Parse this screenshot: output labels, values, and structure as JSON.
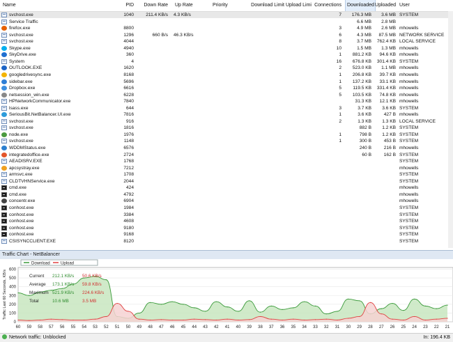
{
  "columns": {
    "name": "Name",
    "pid": "PID",
    "down_rate": "Down Rate",
    "up_rate": "Up Rate",
    "priority": "Priority",
    "download_limit": "Download Limit",
    "upload_limit": "Upload Limit",
    "connections": "Connections",
    "downloaded": "Downloaded",
    "uploaded": "Uploaded",
    "user": "User"
  },
  "rows": [
    {
      "name": "svchost.exe",
      "pid": "1040",
      "down": "211.4 KB/s",
      "up": "4.3 KB/s",
      "conn": "7",
      "dl": "176.3 MB",
      "ul": "3.6 MB",
      "user": "SYSTEM",
      "icon": "app-icon",
      "selected": true
    },
    {
      "name": "Service Traffic",
      "pid": "",
      "down": "",
      "up": "",
      "conn": "",
      "dl": "6.6 MB",
      "ul": "2.8 MB",
      "user": "",
      "icon": "page-icon"
    },
    {
      "name": "firefox.exe",
      "pid": "8800",
      "down": "",
      "up": "",
      "conn": "3",
      "dl": "4.9 MB",
      "ul": "2.6 MB",
      "user": "mhowells",
      "icon": "firefox-icon"
    },
    {
      "name": "svchost.exe",
      "pid": "1296",
      "down": "660 B/s",
      "up": "46.3 KB/s",
      "conn": "6",
      "dl": "4.3 MB",
      "ul": "87.5 MB",
      "user": "NETWORK SERVICE",
      "icon": "app-icon"
    },
    {
      "name": "svchost.exe",
      "pid": "4044",
      "down": "",
      "up": "",
      "conn": "8",
      "dl": "3.7 MB",
      "ul": "762.4 KB",
      "user": "LOCAL SERVICE",
      "icon": "app-icon"
    },
    {
      "name": "Skype.exe",
      "pid": "4940",
      "down": "",
      "up": "",
      "conn": "10",
      "dl": "1.5 MB",
      "ul": "1.3 MB",
      "user": "mhowells",
      "icon": "skype-icon"
    },
    {
      "name": "SkyDrive.exe",
      "pid": "360",
      "down": "",
      "up": "",
      "conn": "1",
      "dl": "881.2 KB",
      "ul": "94.6 KB",
      "user": "mhowells",
      "icon": "skydrive-icon"
    },
    {
      "name": "System",
      "pid": "4",
      "down": "",
      "up": "",
      "conn": "16",
      "dl": "676.8 KB",
      "ul": "301.4 KB",
      "user": "SYSTEM",
      "icon": "page-icon"
    },
    {
      "name": "OUTLOOK.EXE",
      "pid": "1620",
      "down": "",
      "up": "",
      "conn": "2",
      "dl": "523.0 KB",
      "ul": "1.1 MB",
      "user": "mhowells",
      "icon": "outlook-icon"
    },
    {
      "name": "googledrivesync.exe",
      "pid": "8168",
      "down": "",
      "up": "",
      "conn": "1",
      "dl": "206.8 KB",
      "ul": "39.7 KB",
      "user": "mhowells",
      "icon": "drive-icon"
    },
    {
      "name": "sidebar.exe",
      "pid": "5696",
      "down": "",
      "up": "",
      "conn": "1",
      "dl": "137.2 KB",
      "ul": "33.1 KB",
      "user": "mhowells",
      "icon": "sidebar-icon"
    },
    {
      "name": "Dropbox.exe",
      "pid": "6616",
      "down": "",
      "up": "",
      "conn": "5",
      "dl": "119.5 KB",
      "ul": "331.4 KB",
      "user": "mhowells",
      "icon": "dropbox-icon"
    },
    {
      "name": "netsession_win.exe",
      "pid": "6228",
      "down": "",
      "up": "",
      "conn": "5",
      "dl": "103.5 KB",
      "ul": "74.8 KB",
      "user": "mhowells",
      "icon": "netsession-icon"
    },
    {
      "name": "HPNetworkCommunicator.exe",
      "pid": "7840",
      "down": "",
      "up": "",
      "conn": "",
      "dl": "31.3 KB",
      "ul": "12.1 KB",
      "user": "mhowells",
      "icon": "app-icon"
    },
    {
      "name": "lsass.exe",
      "pid": "644",
      "down": "",
      "up": "",
      "conn": "3",
      "dl": "3.7 KB",
      "ul": "3.6 KB",
      "user": "SYSTEM",
      "icon": "app-icon"
    },
    {
      "name": "SeriousBit.NetBalancer.UI.exe",
      "pid": "7816",
      "down": "",
      "up": "",
      "conn": "1",
      "dl": "3.6 KB",
      "ul": "427 B",
      "user": "mhowells",
      "icon": "netbalancer-icon"
    },
    {
      "name": "svchost.exe",
      "pid": "916",
      "down": "",
      "up": "",
      "conn": "2",
      "dl": "1.3 KB",
      "ul": "1.3 KB",
      "user": "LOCAL SERVICE",
      "icon": "app-icon"
    },
    {
      "name": "svchost.exe",
      "pid": "1816",
      "down": "",
      "up": "",
      "conn": "",
      "dl": "882 B",
      "ul": "1.2 KB",
      "user": "SYSTEM",
      "icon": "app-icon"
    },
    {
      "name": "node.exe",
      "pid": "1976",
      "down": "",
      "up": "",
      "conn": "1",
      "dl": "798 B",
      "ul": "1.2 KB",
      "user": "SYSTEM",
      "icon": "node-icon"
    },
    {
      "name": "svchost.exe",
      "pid": "1148",
      "down": "",
      "up": "",
      "conn": "1",
      "dl": "300 B",
      "ul": "453 B",
      "user": "SYSTEM",
      "icon": "app-icon"
    },
    {
      "name": "WDDMStatus.exe",
      "pid": "6576",
      "down": "",
      "up": "",
      "conn": "",
      "dl": "240 B",
      "ul": "216 B",
      "user": "mhowells",
      "icon": "wddm-icon"
    },
    {
      "name": "integratedoffice.exe",
      "pid": "2724",
      "down": "",
      "up": "",
      "conn": "",
      "dl": "60 B",
      "ul": "162 B",
      "user": "SYSTEM",
      "icon": "office-icon"
    },
    {
      "name": "AEADISRV.EXE",
      "pid": "1768",
      "down": "",
      "up": "",
      "conn": "",
      "dl": "",
      "ul": "",
      "user": "SYSTEM",
      "icon": "app-icon"
    },
    {
      "name": "apcsystray.exe",
      "pid": "7212",
      "down": "",
      "up": "",
      "conn": "",
      "dl": "",
      "ul": "",
      "user": "mhowells",
      "icon": "apc-icon"
    },
    {
      "name": "armsvc.exe",
      "pid": "1708",
      "down": "",
      "up": "",
      "conn": "",
      "dl": "",
      "ul": "",
      "user": "SYSTEM",
      "icon": "page-icon"
    },
    {
      "name": "CLDTVHNService.exe",
      "pid": "2044",
      "down": "",
      "up": "",
      "conn": "",
      "dl": "",
      "ul": "",
      "user": "SYSTEM",
      "icon": "app-icon"
    },
    {
      "name": "cmd.exe",
      "pid": "424",
      "down": "",
      "up": "",
      "conn": "",
      "dl": "",
      "ul": "",
      "user": "mhowells",
      "icon": "cmd-icon"
    },
    {
      "name": "cmd.exe",
      "pid": "4792",
      "down": "",
      "up": "",
      "conn": "",
      "dl": "",
      "ul": "",
      "user": "mhowells",
      "icon": "cmd-icon"
    },
    {
      "name": "concentr.exe",
      "pid": "6904",
      "down": "",
      "up": "",
      "conn": "",
      "dl": "",
      "ul": "",
      "user": "mhowells",
      "icon": "concentr-icon"
    },
    {
      "name": "conhost.exe",
      "pid": "1984",
      "down": "",
      "up": "",
      "conn": "",
      "dl": "",
      "ul": "",
      "user": "SYSTEM",
      "icon": "cmd-icon"
    },
    {
      "name": "conhost.exe",
      "pid": "3384",
      "down": "",
      "up": "",
      "conn": "",
      "dl": "",
      "ul": "",
      "user": "SYSTEM",
      "icon": "cmd-icon"
    },
    {
      "name": "conhost.exe",
      "pid": "4608",
      "down": "",
      "up": "",
      "conn": "",
      "dl": "",
      "ul": "",
      "user": "SYSTEM",
      "icon": "cmd-icon"
    },
    {
      "name": "conhost.exe",
      "pid": "9180",
      "down": "",
      "up": "",
      "conn": "",
      "dl": "",
      "ul": "",
      "user": "SYSTEM",
      "icon": "cmd-icon"
    },
    {
      "name": "conhost.exe",
      "pid": "9168",
      "down": "",
      "up": "",
      "conn": "",
      "dl": "",
      "ul": "",
      "user": "SYSTEM",
      "icon": "cmd-icon"
    },
    {
      "name": "CSISYNCCLIENT.EXE",
      "pid": "8120",
      "down": "",
      "up": "",
      "conn": "",
      "dl": "",
      "ul": "",
      "user": "SYSTEM",
      "icon": "app-icon"
    }
  ],
  "panel_title": "Traffic Chart - NetBalancer",
  "status": {
    "left": "Network traffic: Unblocked",
    "right": "In: 196.4 KB"
  },
  "chart_data": {
    "type": "area",
    "legend": [
      "Download",
      "Upload"
    ],
    "colors": {
      "download": "#3a9a3a",
      "download_fill": "#c8e6c0",
      "upload": "#e04040",
      "upload_fill": "#f6d2d2"
    },
    "ylabel": "Traffic Last 60 Seconds, KB/s",
    "yticks": [
      0,
      100,
      200,
      300,
      400,
      500,
      600
    ],
    "ylim": [
      0,
      620
    ],
    "xlim": [
      60,
      21
    ],
    "xticks": [
      60,
      59,
      58,
      57,
      56,
      55,
      54,
      53,
      52,
      51,
      50,
      49,
      48,
      47,
      46,
      45,
      44,
      43,
      42,
      41,
      40,
      39,
      38,
      37,
      36,
      35,
      34,
      33,
      32,
      31,
      30,
      29,
      28,
      27,
      26,
      25,
      24,
      23,
      22,
      21
    ],
    "stats": [
      {
        "label": "Current",
        "down": "212.1 KB/s",
        "up": "50.6 KB/s"
      },
      {
        "label": "Average",
        "down": "173.1 KB/s",
        "up": "59.8 KB/s"
      },
      {
        "label": "Maximum",
        "down": "521.9 KB/s",
        "up": "224.6 KB/s"
      },
      {
        "label": "Total",
        "down": "10.6 MB",
        "up": "3.5 MB"
      }
    ],
    "series": [
      {
        "name": "Download",
        "x": [
          60,
          59,
          58,
          57,
          56,
          55,
          54,
          53,
          52,
          51,
          50,
          49,
          48,
          47,
          46,
          45,
          44,
          43,
          42,
          41,
          40,
          39,
          38,
          37,
          36,
          35,
          34,
          33,
          32,
          31,
          30,
          29,
          28,
          27,
          26,
          25,
          24,
          23,
          22,
          21
        ],
        "values": [
          330,
          300,
          340,
          360,
          380,
          430,
          500,
          520,
          480,
          60,
          40,
          100,
          220,
          200,
          230,
          200,
          160,
          120,
          230,
          170,
          120,
          240,
          110,
          180,
          140,
          160,
          230,
          180,
          90,
          120,
          260,
          240,
          90,
          150,
          210,
          130,
          260,
          180,
          150,
          190
        ]
      },
      {
        "name": "Upload",
        "x": [
          60,
          59,
          58,
          57,
          56,
          55,
          54,
          53,
          52,
          51,
          50,
          49,
          48,
          47,
          46,
          45,
          44,
          43,
          42,
          41,
          40,
          39,
          38,
          37,
          36,
          35,
          34,
          33,
          32,
          31,
          30,
          29,
          28,
          27,
          26,
          25,
          24,
          23,
          22,
          21
        ],
        "values": [
          20,
          15,
          20,
          30,
          25,
          20,
          20,
          30,
          60,
          210,
          120,
          30,
          20,
          25,
          20,
          20,
          30,
          25,
          20,
          30,
          20,
          25,
          60,
          30,
          20,
          30,
          20,
          25,
          30,
          20,
          40,
          60,
          220,
          90,
          30,
          20,
          60,
          20,
          30,
          40
        ]
      }
    ]
  }
}
